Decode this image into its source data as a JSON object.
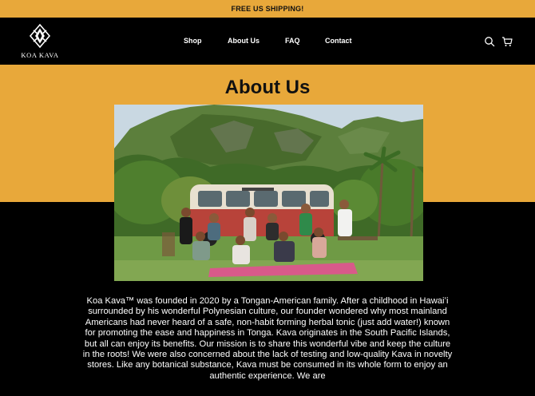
{
  "announcement": {
    "text": "FREE US SHIPPING!"
  },
  "header": {
    "brand": "KOA KAVA",
    "nav": [
      {
        "label": "Shop"
      },
      {
        "label": "About Us"
      },
      {
        "label": "FAQ"
      },
      {
        "label": "Contact"
      }
    ],
    "icons": [
      "search-icon",
      "cart-icon"
    ]
  },
  "main": {
    "title": "About Us",
    "photo": {
      "icon": "team-photo"
    },
    "body_text": "Koa Kava™ was founded in 2020 by a Tongan-American family. After a childhood in Hawaiʻi surrounded by his wonderful Polynesian culture, our founder wondered why most mainland Americans had never heard of a safe, non-habit forming herbal tonic (just add water!) known for promoting the ease and happiness in Tonga. Kava originates in the South Pacific Islands, but all can enjoy its benefits. Our mission is to share this wonderful vibe and keep the culture in the roots! We were also concerned about the lack of testing and low-quality Kava in novelty stores. Like any botanical substance, Kava must be consumed in its whole form to enjoy an authentic experience. We are"
  },
  "colors": {
    "accent": "#e8a83a",
    "background": "#000000",
    "text": "#ffffff"
  }
}
